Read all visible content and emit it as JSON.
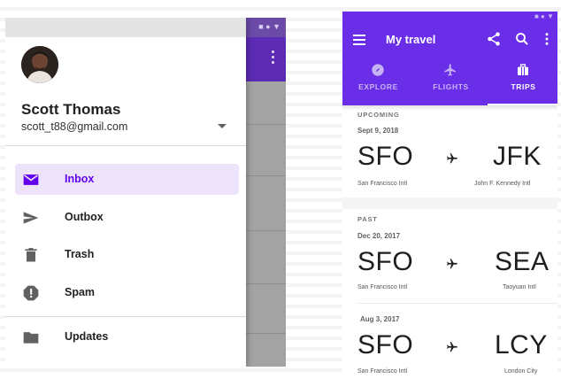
{
  "drawer": {
    "user_name": "Scott Thomas",
    "user_email": "scott_t88@gmail.com",
    "items": [
      {
        "label": "Inbox",
        "icon": "mail-icon",
        "active": true
      },
      {
        "label": "Outbox",
        "icon": "send-icon",
        "active": false
      },
      {
        "label": "Trash",
        "icon": "trash-icon",
        "active": false
      },
      {
        "label": "Spam",
        "icon": "spam-icon",
        "active": false
      },
      {
        "label": "Updates",
        "icon": "folder-icon",
        "active": false
      }
    ]
  },
  "travel": {
    "title": "My travel",
    "tabs": [
      {
        "label": "EXPLORE",
        "icon": "explore-icon",
        "active": false
      },
      {
        "label": "FLIGHTS",
        "icon": "flight-icon",
        "active": false
      },
      {
        "label": "TRIPS",
        "icon": "suitcase-icon",
        "active": true
      }
    ],
    "upcoming_label": "UPCOMING",
    "past_label": "PAST",
    "trips": [
      {
        "date": "Sept 9, 2018",
        "from_code": "SFO",
        "to_code": "JFK",
        "from_name": "San Francisco Intl",
        "to_name": "John F. Kennedy Intl"
      },
      {
        "date": "Dec 20, 2017",
        "from_code": "SFO",
        "to_code": "SEA",
        "from_name": "San Francisco Intl",
        "to_name": "Taoyuan Intl"
      },
      {
        "date": "Aug 3, 2017",
        "from_code": "SFO",
        "to_code": "LCY",
        "from_name": "San Francisco Intl",
        "to_name": "London City"
      }
    ]
  },
  "colors": {
    "primary": "#6a2ee8",
    "active_item_bg": "#ede3fb",
    "active_item_text": "#6200ee"
  }
}
